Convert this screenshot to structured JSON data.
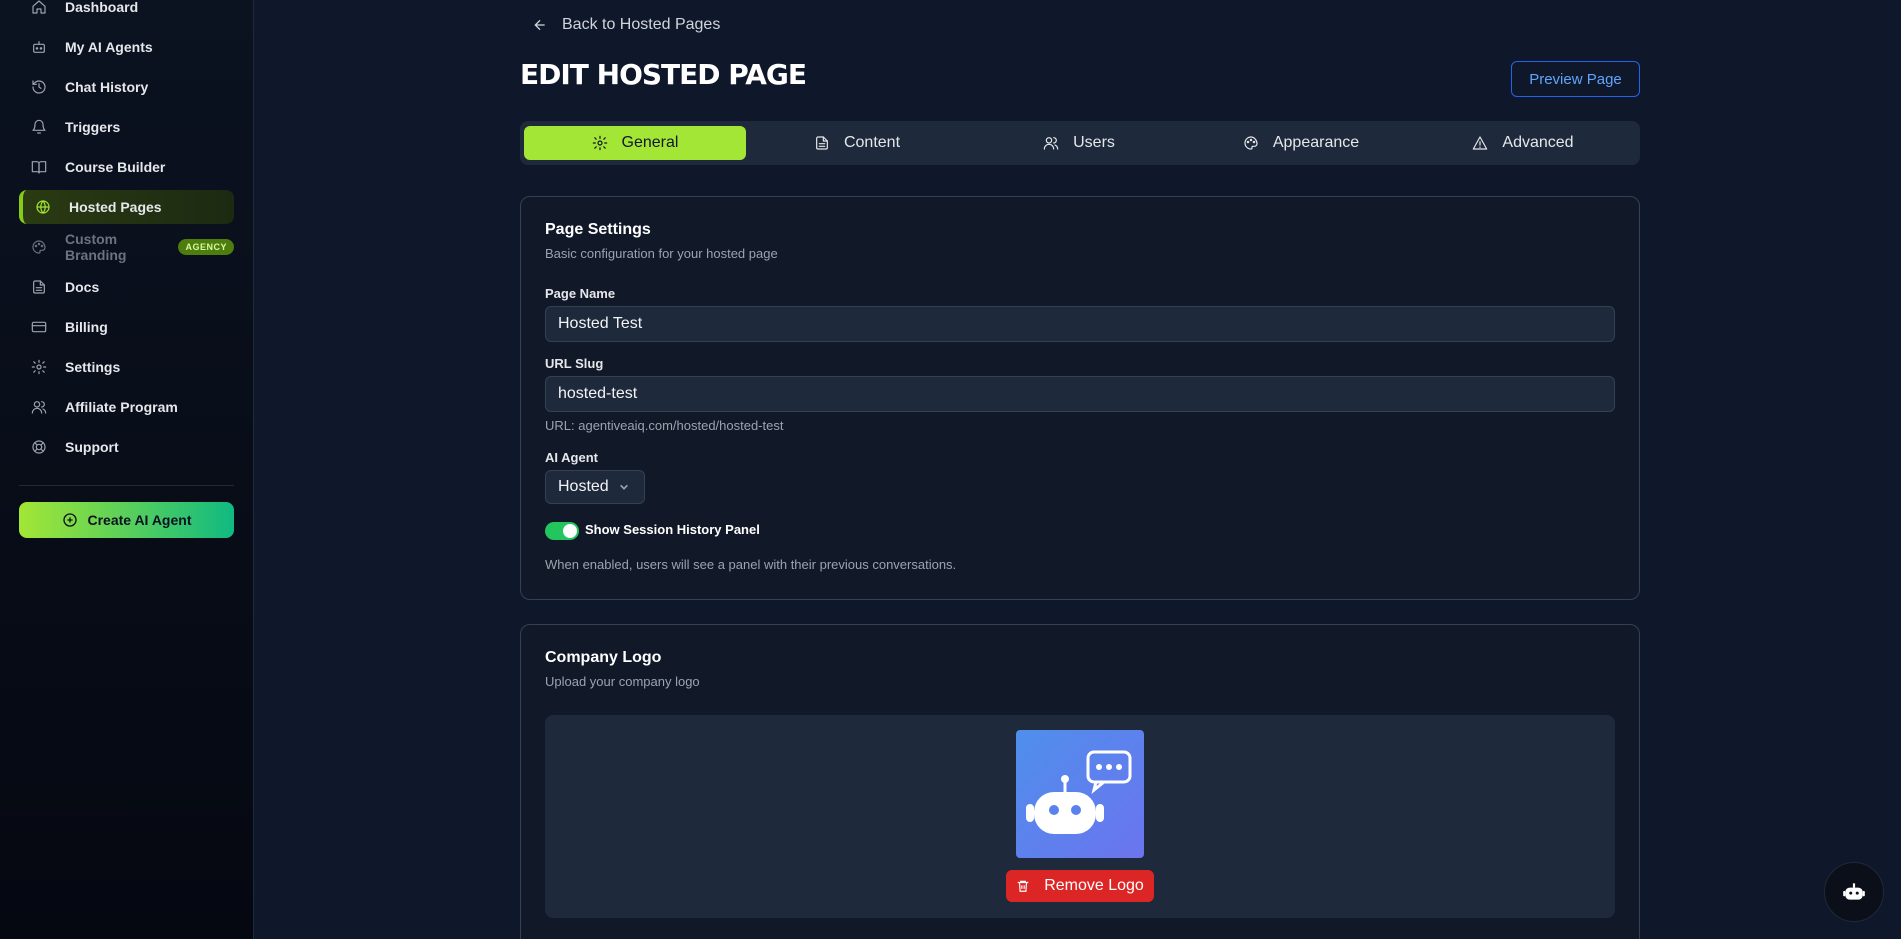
{
  "sidebar": {
    "items": [
      {
        "label": "Dashboard",
        "icon": "home-icon"
      },
      {
        "label": "My AI Agents",
        "icon": "bot-icon"
      },
      {
        "label": "Chat History",
        "icon": "history-icon"
      },
      {
        "label": "Triggers",
        "icon": "bell-icon"
      },
      {
        "label": "Course Builder",
        "icon": "book-icon"
      },
      {
        "label": "Hosted Pages",
        "icon": "globe-icon"
      },
      {
        "label": "Custom Branding",
        "icon": "palette-icon",
        "badge": "AGENCY"
      },
      {
        "label": "Docs",
        "icon": "file-icon"
      },
      {
        "label": "Billing",
        "icon": "credit-card-icon"
      },
      {
        "label": "Settings",
        "icon": "gear-icon"
      },
      {
        "label": "Affiliate Program",
        "icon": "users-icon"
      },
      {
        "label": "Support",
        "icon": "lifebuoy-icon"
      }
    ],
    "create_label": "Create AI Agent"
  },
  "header": {
    "back_label": "Back to Hosted Pages",
    "title": "EDIT HOSTED PAGE",
    "preview_label": "Preview Page"
  },
  "tabs": [
    {
      "label": "General",
      "icon": "gear-icon"
    },
    {
      "label": "Content",
      "icon": "file-text-icon"
    },
    {
      "label": "Users",
      "icon": "users-icon"
    },
    {
      "label": "Appearance",
      "icon": "palette-icon"
    },
    {
      "label": "Advanced",
      "icon": "warning-icon"
    }
  ],
  "page_settings": {
    "title": "Page Settings",
    "subtitle": "Basic configuration for your hosted page",
    "page_name_label": "Page Name",
    "page_name_value": "Hosted Test",
    "url_slug_label": "URL Slug",
    "url_slug_value": "hosted-test",
    "url_hint": "URL: agentiveaiq.com/hosted/hosted-test",
    "ai_agent_label": "AI Agent",
    "ai_agent_value": "Hosted",
    "session_toggle_label": "Show Session History Panel",
    "session_toggle_on": true,
    "session_hint": "When enabled, users will see a panel with their previous conversations."
  },
  "company_logo": {
    "title": "Company Logo",
    "subtitle": "Upload your company logo",
    "remove_label": "Remove Logo"
  },
  "colors": {
    "accent": "#a3e635",
    "danger": "#dc2626",
    "link": "#60a5fa"
  }
}
